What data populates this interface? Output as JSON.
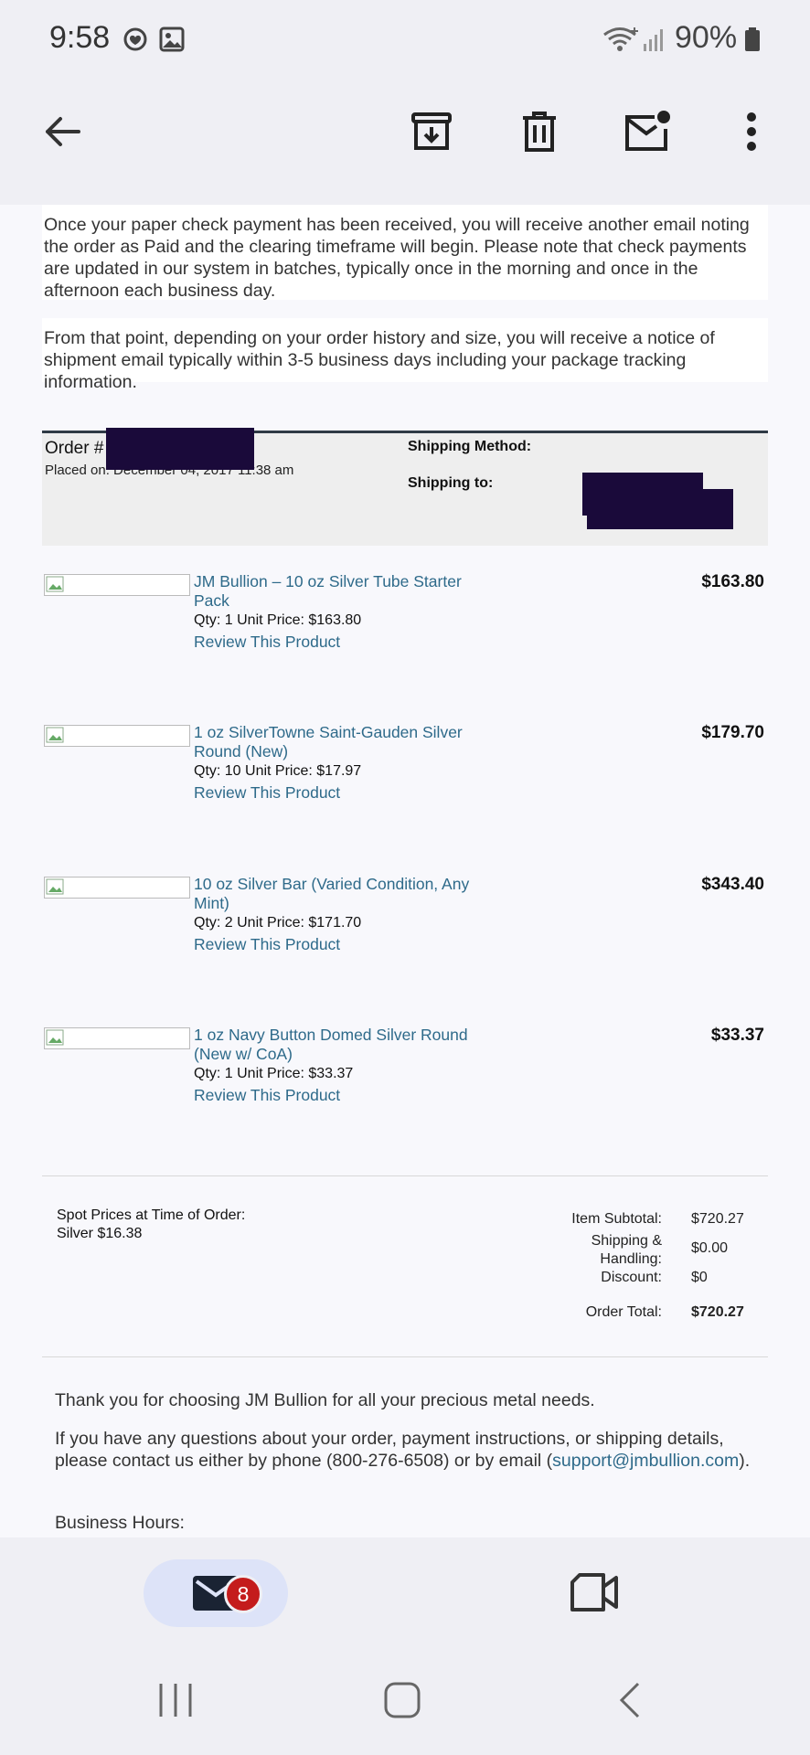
{
  "status_bar": {
    "time": "9:58",
    "battery": "90%"
  },
  "toolbar": {
    "back_icon": "arrow-back-icon",
    "archive_icon": "archive-icon",
    "delete_icon": "trash-icon",
    "mark_unread_icon": "mail-unread-icon",
    "more_icon": "more-vert-icon"
  },
  "email": {
    "paragraph1": "Once your paper check payment has been received, you will receive another email noting the order as Paid and the clearing timeframe will begin. Please note that check payments are updated in our system in batches, typically once in the morning and once in the afternoon each business day.",
    "paragraph2": "From that point, depending on your order history and size, you will receive a notice of shipment email typically within 3-5 business days including your package tracking information.",
    "order": {
      "order_label": "Order #",
      "placed_on": "Placed on: December 04, 2017 11:38 am",
      "shipping_method_label": "Shipping Method:",
      "shipping_to_label": "Shipping to:"
    },
    "items": [
      {
        "name": "JM Bullion – 10 oz Silver Tube Starter Pack",
        "qty_line": "Qty: 1 Unit Price: $163.80",
        "review": "Review This Product",
        "price": "$163.80"
      },
      {
        "name": "1 oz SilverTowne Saint-Gauden Silver Round (New)",
        "qty_line": "Qty: 10 Unit Price: $17.97",
        "review": "Review This Product",
        "price": "$179.70"
      },
      {
        "name": "10 oz Silver Bar (Varied Condition, Any Mint)",
        "qty_line": "Qty: 2 Unit Price: $171.70",
        "review": "Review This Product",
        "price": "$343.40"
      },
      {
        "name": "1 oz Navy Button Domed Silver Round (New w/ CoA)",
        "qty_line": "Qty: 1 Unit Price: $33.37",
        "review": "Review This Product",
        "price": "$33.37"
      }
    ],
    "spot": {
      "label": "Spot Prices at Time of Order:",
      "silver": "Silver $16.38"
    },
    "totals": {
      "subtotal_label": "Item Subtotal:",
      "subtotal_value": "$720.27",
      "shipping_label_line1": "Shipping &",
      "shipping_label_line2": "Handling:",
      "shipping_value": "$0.00",
      "discount_label": "Discount:",
      "discount_value": "$0",
      "order_total_label": "Order Total:",
      "order_total_value": "$720.27"
    },
    "footer": {
      "thanks": "Thank you for choosing JM Bullion for all your precious metal needs.",
      "contact_prefix": "If you have any questions about your order, payment instructions, or shipping details, please contact us either by phone (800-276-6508) or by email (",
      "contact_email": "support@jmbullion.com",
      "contact_suffix": ").",
      "business_hours": "Business Hours:"
    }
  },
  "bottom_nav": {
    "mail_badge": "8",
    "mail_icon": "mail-icon",
    "meet_icon": "video-camera-icon"
  },
  "colors": {
    "link": "#2e6a8a",
    "badge": "#c41c1c",
    "pill": "#dde3f8",
    "chrome": "#efeff4"
  }
}
